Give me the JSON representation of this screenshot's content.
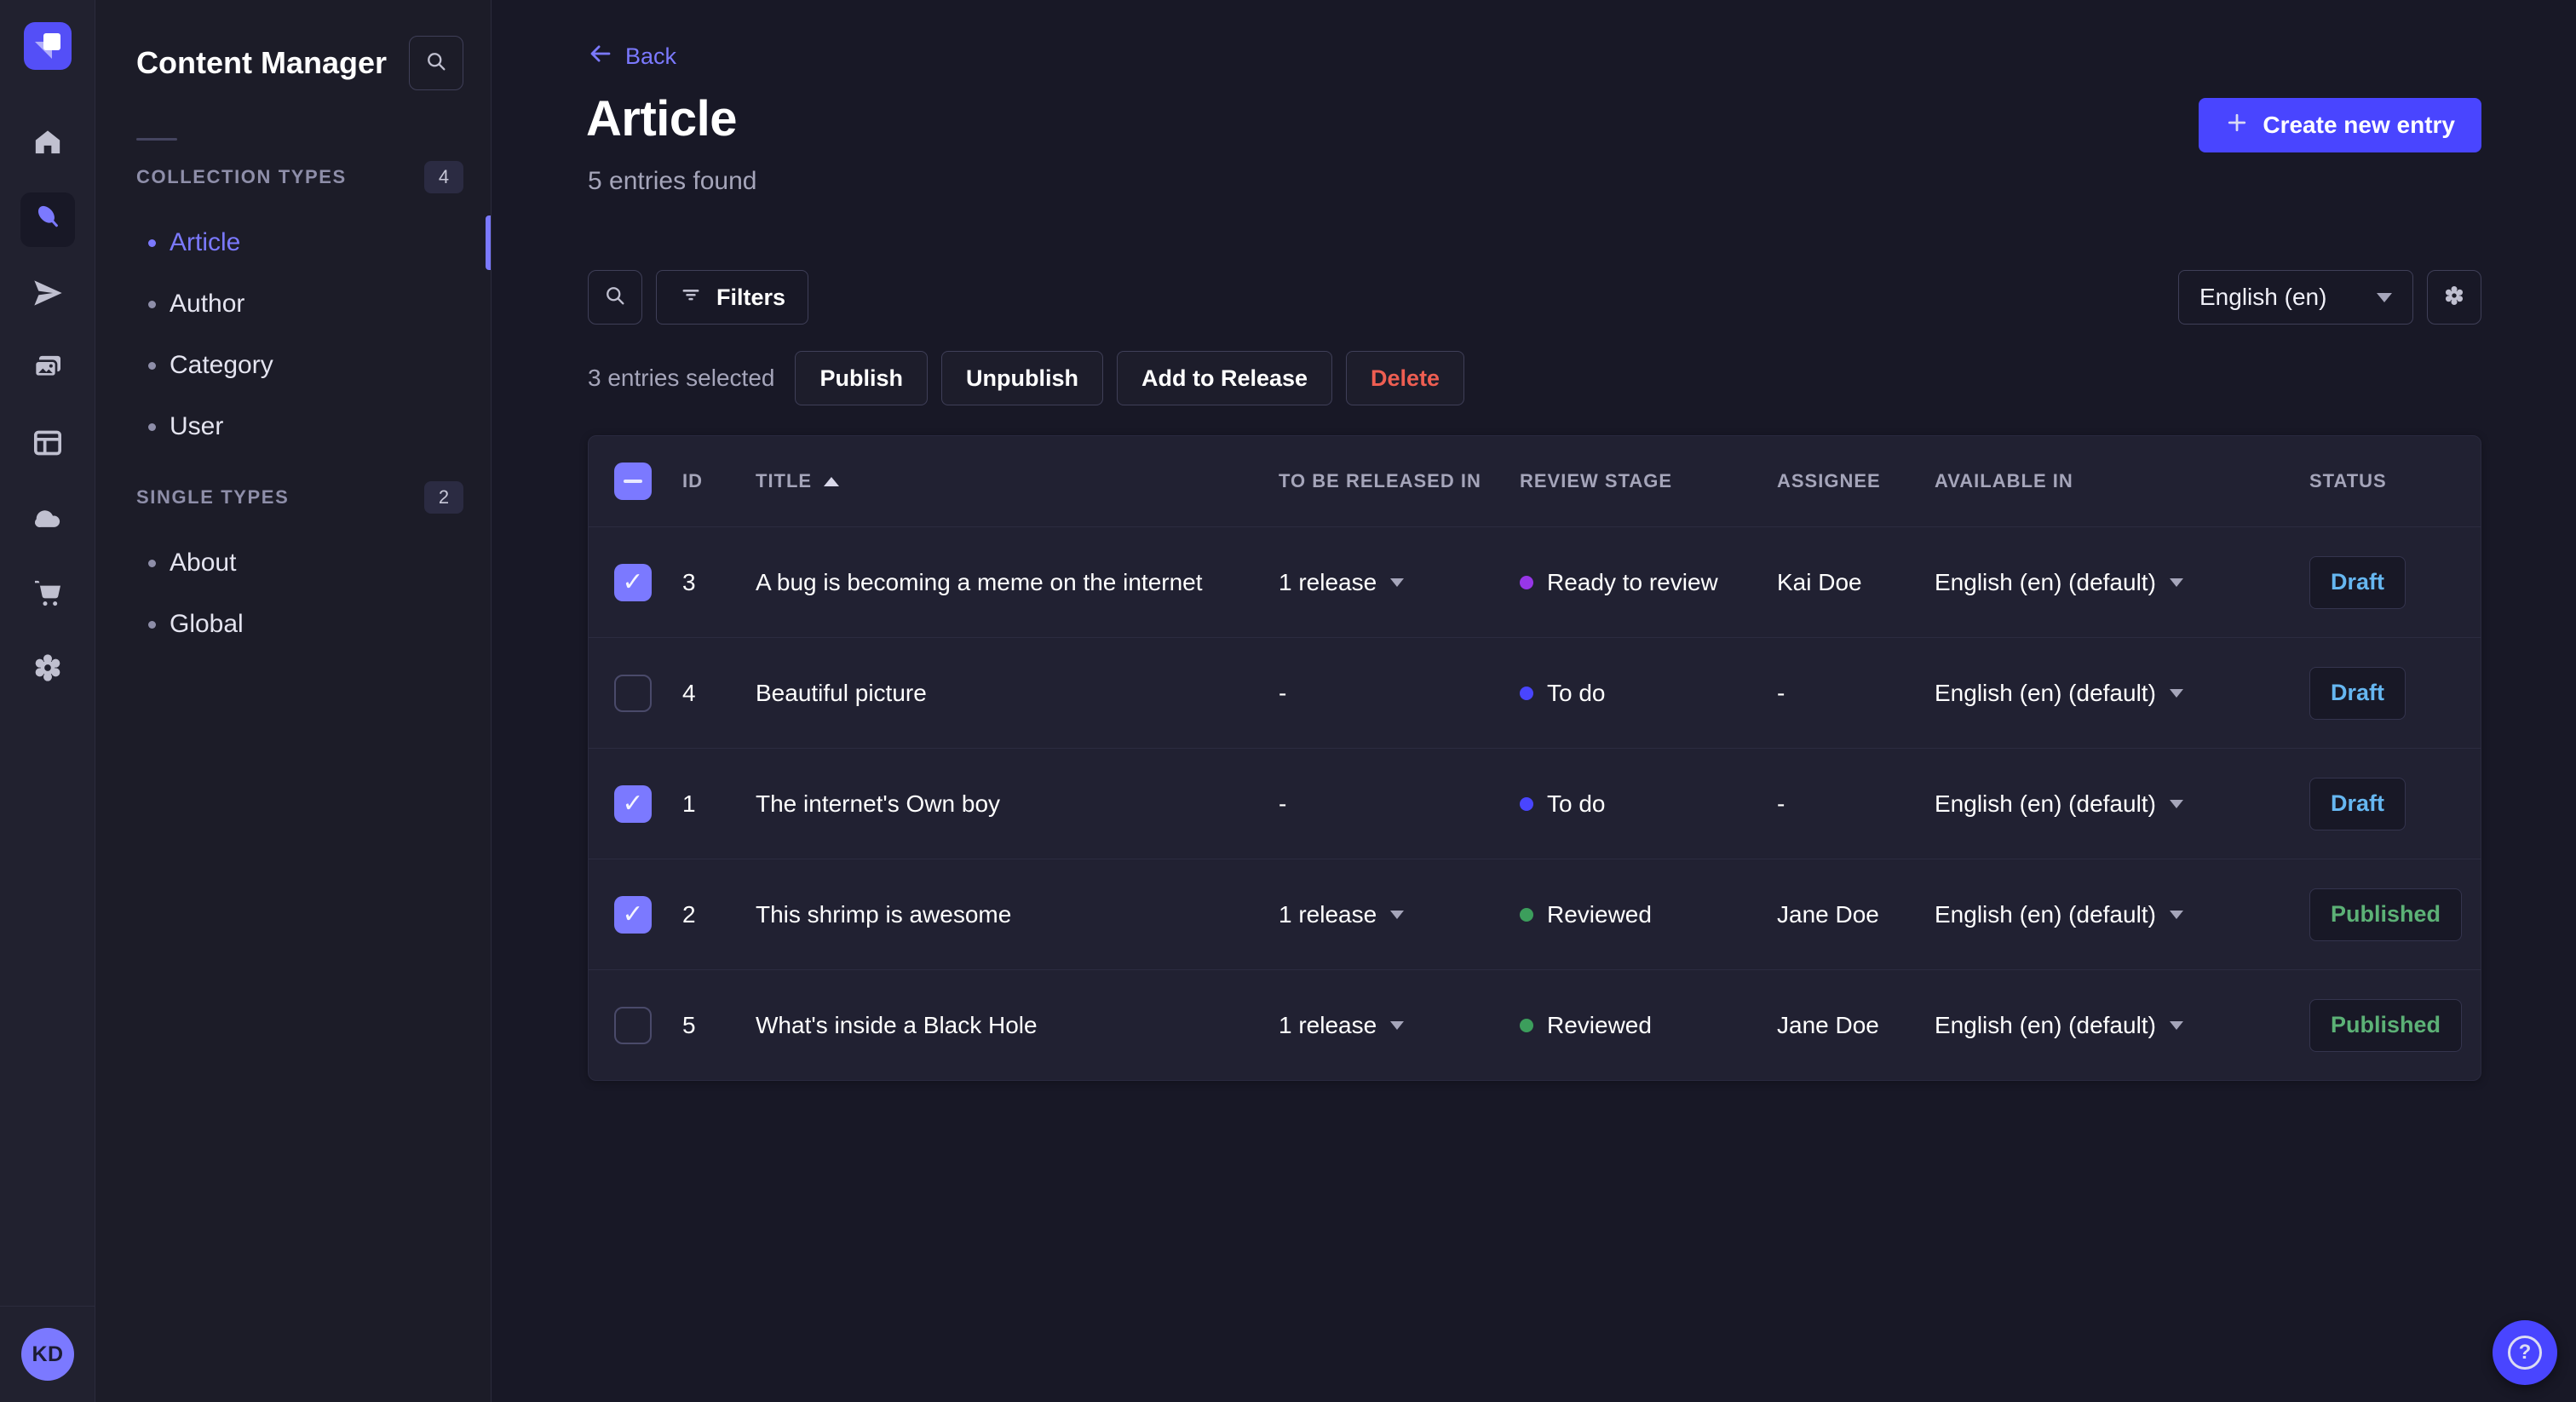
{
  "rail": {
    "avatar_initials": "KD",
    "items": [
      "home",
      "content-manager",
      "releases",
      "media-library",
      "content-type-builder",
      "deploy",
      "marketplace",
      "settings"
    ],
    "active_item": "content-manager"
  },
  "sidebar": {
    "title": "Content Manager",
    "sections": [
      {
        "label": "COLLECTION TYPES",
        "count": "4",
        "items": [
          {
            "label": "Article",
            "active": true
          },
          {
            "label": "Author"
          },
          {
            "label": "Category"
          },
          {
            "label": "User"
          }
        ]
      },
      {
        "label": "SINGLE TYPES",
        "count": "2",
        "items": [
          {
            "label": "About"
          },
          {
            "label": "Global"
          }
        ]
      }
    ]
  },
  "header": {
    "back_label": "Back",
    "title": "Article",
    "entries_count_text": "5 entries found",
    "create_button_label": "Create new entry"
  },
  "toolbar": {
    "filters_label": "Filters",
    "locale_selected": "English (en)"
  },
  "selection": {
    "summary": "3 entries selected",
    "publish_label": "Publish",
    "unpublish_label": "Unpublish",
    "add_to_release_label": "Add to Release",
    "delete_label": "Delete"
  },
  "table": {
    "columns": {
      "id": "ID",
      "title": "TITLE",
      "to_be_released_in": "TO BE RELEASED IN",
      "review_stage": "REVIEW STAGE",
      "assignee": "ASSIGNEE",
      "available_in": "AVAILABLE IN",
      "status": "STATUS"
    },
    "sort": {
      "column": "TITLE",
      "direction": "ascending"
    },
    "header_checkbox": "indeterminate",
    "rows": [
      {
        "checkbox": "checked",
        "id": "3",
        "title": "A bug is becoming a meme on the internet",
        "release": "1 release",
        "release_caret": "true",
        "stage": "Ready to review",
        "stage_key": "ready",
        "assignee": "Kai Doe",
        "available_in": "English (en) (default)",
        "status": "Draft",
        "status_key": "draft"
      },
      {
        "checkbox": "unchecked",
        "id": "4",
        "title": "Beautiful picture",
        "release": "-",
        "release_caret": "false",
        "stage": "To do",
        "stage_key": "todo",
        "assignee": "-",
        "available_in": "English (en) (default)",
        "status": "Draft",
        "status_key": "draft"
      },
      {
        "checkbox": "checked",
        "id": "1",
        "title": "The internet's Own boy",
        "release": "-",
        "release_caret": "false",
        "stage": "To do",
        "stage_key": "todo",
        "assignee": "-",
        "available_in": "English (en) (default)",
        "status": "Draft",
        "status_key": "draft"
      },
      {
        "checkbox": "checked",
        "id": "2",
        "title": "This shrimp is awesome",
        "release": "1 release",
        "release_caret": "true",
        "stage": "Reviewed",
        "stage_key": "reviewed",
        "assignee": "Jane Doe",
        "available_in": "English (en) (default)",
        "status": "Published",
        "status_key": "published"
      },
      {
        "checkbox": "unchecked",
        "id": "5",
        "title": "What's inside a Black Hole",
        "release": "1 release",
        "release_caret": "true",
        "stage": "Reviewed",
        "stage_key": "reviewed",
        "assignee": "Jane Doe",
        "available_in": "English (en) (default)",
        "status": "Published",
        "status_key": "published"
      }
    ]
  },
  "colors": {
    "accent": "#4945ff",
    "accent_light": "#7b79ff",
    "danger": "#ee5e52",
    "success": "#5cb176",
    "draft_blue": "#66b7f1",
    "stage_todo": "#4945ff",
    "stage_ready": "#9736e8",
    "stage_reviewed": "#3c9e5c"
  },
  "icons": [
    "strapi-logo",
    "home",
    "feather",
    "paper-plane",
    "images",
    "layout",
    "cloud",
    "cart",
    "gear",
    "search",
    "filter",
    "plus",
    "arrow-left",
    "chevron-down",
    "sort-ascending",
    "question-mark"
  ]
}
